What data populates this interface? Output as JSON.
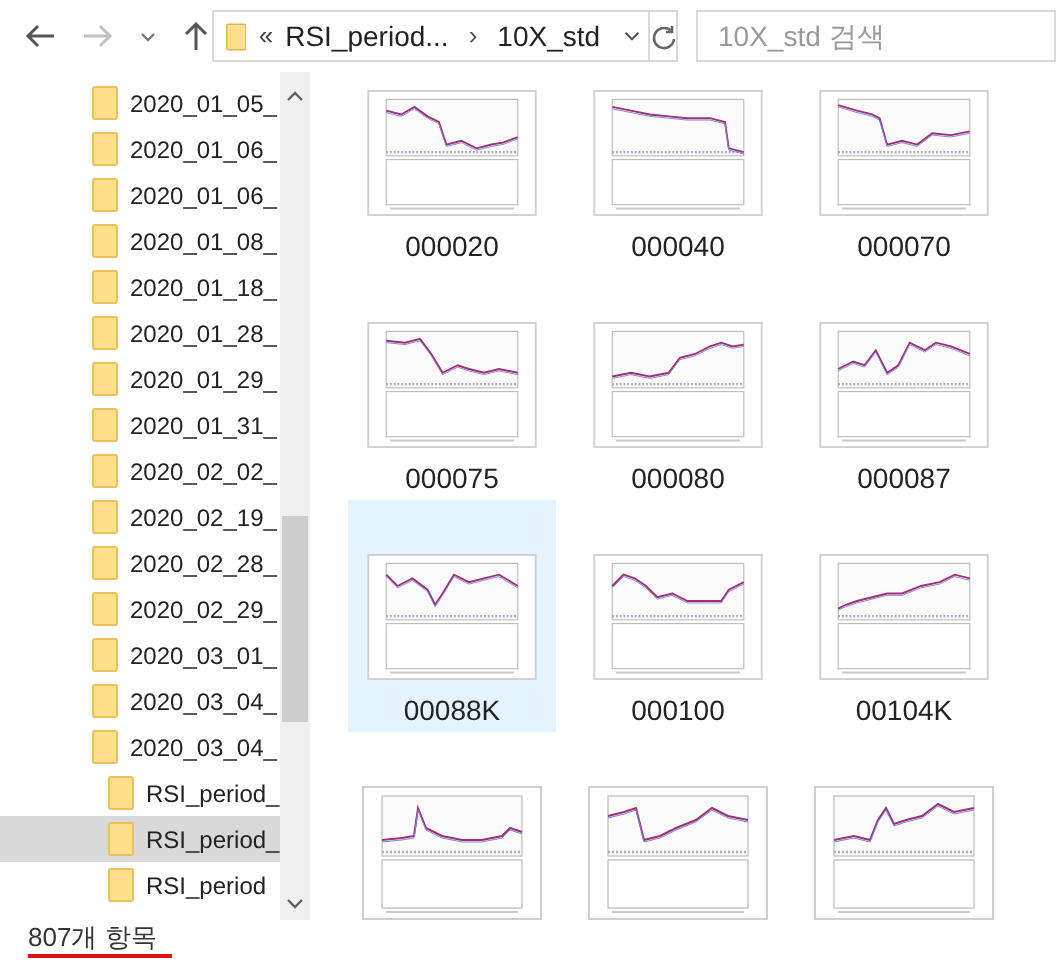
{
  "toolbar": {
    "back": {
      "disabled": false
    },
    "forward": {
      "disabled": true
    },
    "address": {
      "overflow": "«",
      "crumbs": [
        "RSI_period...",
        "10X_std"
      ],
      "separator": "›"
    },
    "search": {
      "placeholder": "10X_std 검색"
    }
  },
  "navigation": {
    "items": [
      {
        "label": "2020_01_05_",
        "selected": false
      },
      {
        "label": "2020_01_06_",
        "selected": false
      },
      {
        "label": "2020_01_06_",
        "selected": false
      },
      {
        "label": "2020_01_08_",
        "selected": false
      },
      {
        "label": "2020_01_18_",
        "selected": false
      },
      {
        "label": "2020_01_28_",
        "selected": false
      },
      {
        "label": "2020_01_29_",
        "selected": false
      },
      {
        "label": "2020_01_31_",
        "selected": false
      },
      {
        "label": "2020_02_02_",
        "selected": false
      },
      {
        "label": "2020_02_19_",
        "selected": false
      },
      {
        "label": "2020_02_28_",
        "selected": false
      },
      {
        "label": "2020_02_29_",
        "selected": false
      },
      {
        "label": "2020_03_01_",
        "selected": false
      },
      {
        "label": "2020_03_04_",
        "selected": false
      },
      {
        "label": "2020_03_04_",
        "selected": false,
        "children": [
          {
            "label": "RSI_period_",
            "selected": false
          },
          {
            "label": "RSI_period_",
            "selected": true
          },
          {
            "label": "RSI_period",
            "selected": false
          }
        ]
      }
    ]
  },
  "files": [
    {
      "name": "000020",
      "selected": false
    },
    {
      "name": "000040",
      "selected": false
    },
    {
      "name": "000070",
      "selected": false
    },
    {
      "name": "000075",
      "selected": false
    },
    {
      "name": "000080",
      "selected": false
    },
    {
      "name": "000087",
      "selected": false
    },
    {
      "name": "00088K",
      "selected": true
    },
    {
      "name": "000100",
      "selected": false
    },
    {
      "name": "00104K",
      "selected": false
    },
    {
      "selected": false
    },
    {
      "selected": false
    },
    {
      "selected": false
    }
  ],
  "status_bar": {
    "item_count": "807개 항목"
  }
}
